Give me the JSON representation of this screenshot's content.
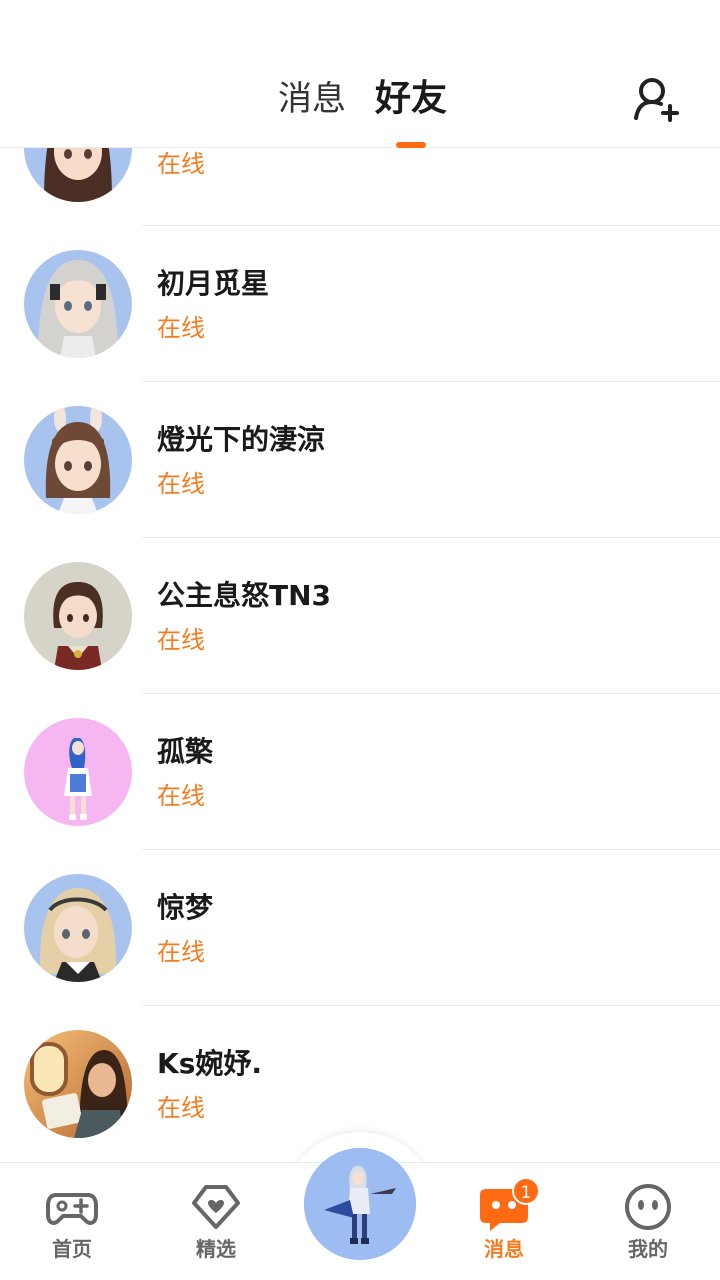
{
  "header": {
    "tab_messages": "消息",
    "tab_friends": "好友",
    "active_tab": "好友",
    "add_friend_icon": "add-user-icon"
  },
  "friends": [
    {
      "name": "",
      "status": "在线",
      "avatar_bg": "#a9c3ef"
    },
    {
      "name": "初月觅星",
      "status": "在线",
      "avatar_bg": "#a9c3ef"
    },
    {
      "name": "燈光下的淒涼",
      "status": "在线",
      "avatar_bg": "#a9c3ef"
    },
    {
      "name": "公主息怒TN3",
      "status": "在线",
      "avatar_bg": "#d6d3c9"
    },
    {
      "name": "孤檠",
      "status": "在线",
      "avatar_bg": "#f6b6f2"
    },
    {
      "name": "惊梦",
      "status": "在线",
      "avatar_bg": "#a9c3ef"
    },
    {
      "name": "Ks婉妤.",
      "status": "在线",
      "avatar_bg": "#e7a35e"
    }
  ],
  "bottom_nav": {
    "items": [
      {
        "label": "首页",
        "icon": "gamepad-icon"
      },
      {
        "label": "精选",
        "icon": "heart-icon"
      },
      {
        "label": "",
        "icon": "character-avatar"
      },
      {
        "label": "消息",
        "icon": "chat-bubble-icon",
        "badge": "1"
      },
      {
        "label": "我的",
        "icon": "face-icon"
      }
    ],
    "active": "消息"
  },
  "colors": {
    "accent": "#f57c1f",
    "indicator": "#ff6a13"
  }
}
